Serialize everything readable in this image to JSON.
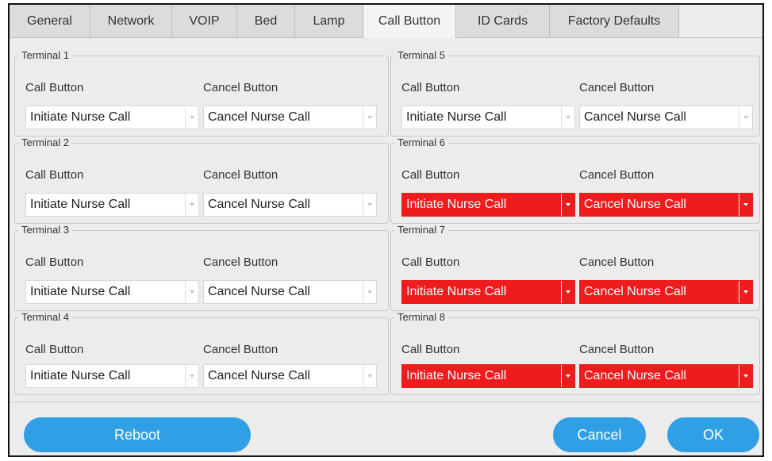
{
  "tabs": [
    {
      "label": "General"
    },
    {
      "label": "Network"
    },
    {
      "label": "VOIP"
    },
    {
      "label": "Bed"
    },
    {
      "label": "Lamp"
    },
    {
      "label": "Call Button"
    },
    {
      "label": "ID Cards"
    },
    {
      "label": "Factory Defaults"
    }
  ],
  "active_tab": "Call Button",
  "field_labels": {
    "call": "Call Button",
    "cancel": "Cancel Button"
  },
  "terminals": [
    {
      "title": "Terminal 1",
      "call_value": "Initiate Nurse Call",
      "cancel_value": "Cancel Nurse Call",
      "error": false
    },
    {
      "title": "Terminal 2",
      "call_value": "Initiate Nurse Call",
      "cancel_value": "Cancel Nurse Call",
      "error": false
    },
    {
      "title": "Terminal 3",
      "call_value": "Initiate Nurse Call",
      "cancel_value": "Cancel Nurse Call",
      "error": false
    },
    {
      "title": "Terminal 4",
      "call_value": "Initiate Nurse Call",
      "cancel_value": "Cancel Nurse Call",
      "error": false
    },
    {
      "title": "Terminal 5",
      "call_value": "Initiate Nurse Call",
      "cancel_value": "Cancel Nurse Call",
      "error": false
    },
    {
      "title": "Terminal 6",
      "call_value": "Initiate Nurse Call",
      "cancel_value": "Cancel Nurse Call",
      "error": true
    },
    {
      "title": "Terminal 7",
      "call_value": "Initiate Nurse Call",
      "cancel_value": "Cancel Nurse Call",
      "error": true
    },
    {
      "title": "Terminal 8",
      "call_value": "Initiate Nurse Call",
      "cancel_value": "Cancel Nurse Call",
      "error": true
    }
  ],
  "buttons": {
    "reboot": "Reboot",
    "cancel": "Cancel",
    "ok": "OK"
  },
  "colors": {
    "accent": "#2f9fe6",
    "error": "#ee1c1c"
  }
}
